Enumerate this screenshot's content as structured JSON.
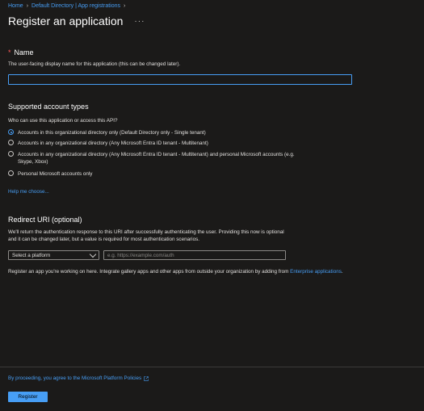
{
  "breadcrumb": {
    "items": [
      "Home",
      "Default Directory | App registrations"
    ]
  },
  "page": {
    "title": "Register an application",
    "more": "···"
  },
  "name_section": {
    "title": "Name",
    "required_marker": "*",
    "description": "The user-facing display name for this application (this can be changed later).",
    "value": ""
  },
  "account_types": {
    "title": "Supported account types",
    "question": "Who can use this application or access this API?",
    "options": [
      {
        "label": "Accounts in this organizational directory only (Default Directory only - Single tenant)",
        "checked": true
      },
      {
        "label": "Accounts in any organizational directory (Any Microsoft Entra ID tenant - Multitenant)",
        "checked": false
      },
      {
        "label": "Accounts in any organizational directory (Any Microsoft Entra ID tenant - Multitenant) and personal Microsoft accounts (e.g. Skype, Xbox)",
        "checked": false
      },
      {
        "label": "Personal Microsoft accounts only",
        "checked": false
      }
    ],
    "help_link": "Help me choose..."
  },
  "redirect": {
    "title": "Redirect URI (optional)",
    "description": "We'll return the authentication response to this URI after successfully authenticating the user. Providing this now is optional and it can be changed later, but a value is required for most authentication scenarios.",
    "platform_selected": "Select a platform",
    "uri_placeholder": "e.g. https://example.com/auth",
    "note_prefix": "Register an app you're working on here. Integrate gallery apps and other apps from outside your organization by adding from ",
    "note_link": "Enterprise applications",
    "note_suffix": "."
  },
  "footer": {
    "policy_text": "By proceeding, you agree to the Microsoft Platform Policies",
    "register_label": "Register"
  },
  "colors": {
    "accent": "#479ef5",
    "background": "#1b1a19",
    "required": "#ff5a5a"
  }
}
